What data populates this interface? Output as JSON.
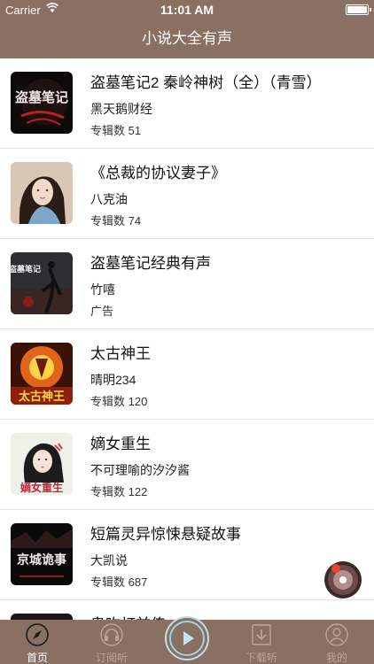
{
  "status_bar": {
    "carrier": "Carrier",
    "time": "11:01 AM"
  },
  "nav": {
    "title": "小说大全有声"
  },
  "albums": [
    {
      "title": "盗墓笔记2 秦岭神树（全）（青雪）",
      "author": "黑天鹅财经",
      "meta": "专辑数 51",
      "cover_icon": "tomb-notes-cover"
    },
    {
      "title": "《总裁的协议妻子》",
      "author": "八克油",
      "meta": "专辑数 74",
      "cover_icon": "ceo-wife-cover"
    },
    {
      "title": "盗墓笔记经典有声",
      "author": "竹嘻",
      "meta": "广告",
      "cover_icon": "tomb-classic-cover"
    },
    {
      "title": "太古神王",
      "author": "晴明234",
      "meta": "专辑数 120",
      "cover_icon": "ancient-god-king-cover"
    },
    {
      "title": "嫡女重生",
      "author": "不可理喻的汐汐酱",
      "meta": "专辑数 122",
      "cover_icon": "legitimate-daughter-cover"
    },
    {
      "title": "短篇灵异惊悚悬疑故事",
      "author": "大凯说",
      "meta": "专辑数 687",
      "cover_icon": "thriller-stories-cover"
    },
    {
      "title": "鬼吹灯前传",
      "author": "",
      "meta": "",
      "cover_icon": "partial-cover"
    }
  ],
  "cover_overlay_text": {
    "tomb_notes": "盗墓笔记",
    "tomb_classic": "盗墓笔记",
    "ancient_god_king": "太古神王",
    "legitimate_daughter": "嫡女重生",
    "thriller": "京城诡事"
  },
  "tabs": [
    {
      "label": "首页",
      "icon": "compass-icon",
      "active": true
    },
    {
      "label": "订阅听",
      "icon": "headphones-icon",
      "active": false
    },
    {
      "label": "",
      "icon": "play-icon",
      "active": false
    },
    {
      "label": "下载听",
      "icon": "download-icon",
      "active": false
    },
    {
      "label": "我的",
      "icon": "user-icon",
      "active": false
    }
  ],
  "colors": {
    "bar_brown": "#8a6f63",
    "tab_inactive": "#b7a69d",
    "play_ring": "#bfe0ea"
  }
}
